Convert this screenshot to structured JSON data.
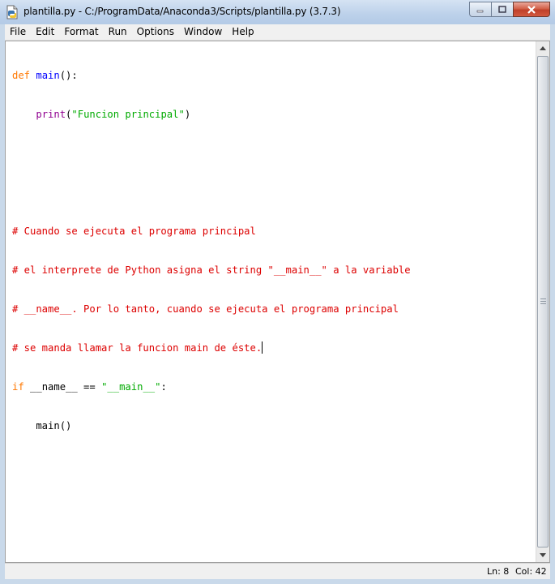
{
  "window": {
    "title": "plantilla.py - C:/ProgramData/Anaconda3/Scripts/plantilla.py (3.7.3)"
  },
  "menu": {
    "items": [
      "File",
      "Edit",
      "Format",
      "Run",
      "Options",
      "Window",
      "Help"
    ]
  },
  "editor": {
    "lines": {
      "l1": {
        "kw": "def",
        "name": "main",
        "rest": "():"
      },
      "l2": {
        "indent": "    ",
        "bi": "print",
        "open": "(",
        "str": "\"Funcion principal\"",
        "close": ")"
      },
      "l5": "# Cuando se ejecuta el programa principal",
      "l6": "# el interprete de Python asigna el string \"__main__\" a la variable",
      "l7": "# __name__. Por lo tanto, cuando se ejecuta el programa principal",
      "l8": "# se manda llamar la funcion main de éste.",
      "l9": {
        "kw": "if",
        "rest": " __name__ == ",
        "str": "\"__main__\"",
        "end": ":"
      },
      "l10": "    main()"
    }
  },
  "status": {
    "ln": "Ln: 8",
    "col": "Col: 42"
  },
  "colors": {
    "keyword": "#ff7700",
    "builtin": "#900090",
    "definition": "#0000ff",
    "string": "#00aa00",
    "comment": "#dd0000"
  }
}
